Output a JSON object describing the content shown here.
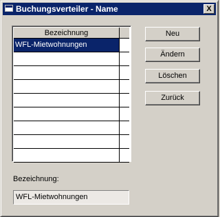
{
  "window": {
    "title": "Buchungsverteiler - Name",
    "close_label": "X"
  },
  "grid": {
    "columns": [
      "Bezeichnung",
      ""
    ],
    "rows": [
      {
        "bezeichnung": "WFL-Mietwohnungen",
        "extra": "",
        "selected": true
      },
      {
        "bezeichnung": "",
        "extra": "",
        "selected": false
      },
      {
        "bezeichnung": "",
        "extra": "",
        "selected": false
      },
      {
        "bezeichnung": "",
        "extra": "",
        "selected": false
      },
      {
        "bezeichnung": "",
        "extra": "",
        "selected": false
      },
      {
        "bezeichnung": "",
        "extra": "",
        "selected": false
      },
      {
        "bezeichnung": "",
        "extra": "",
        "selected": false
      },
      {
        "bezeichnung": "",
        "extra": "",
        "selected": false
      },
      {
        "bezeichnung": "",
        "extra": "",
        "selected": false
      }
    ]
  },
  "buttons": {
    "new_label": "Neu",
    "edit_label": "Ändern",
    "delete_label": "Löschen",
    "back_label": "Zurück"
  },
  "form": {
    "bezeichnung_label": "Bezeichnung:",
    "bezeichnung_value": "WFL-Mietwohnungen"
  }
}
